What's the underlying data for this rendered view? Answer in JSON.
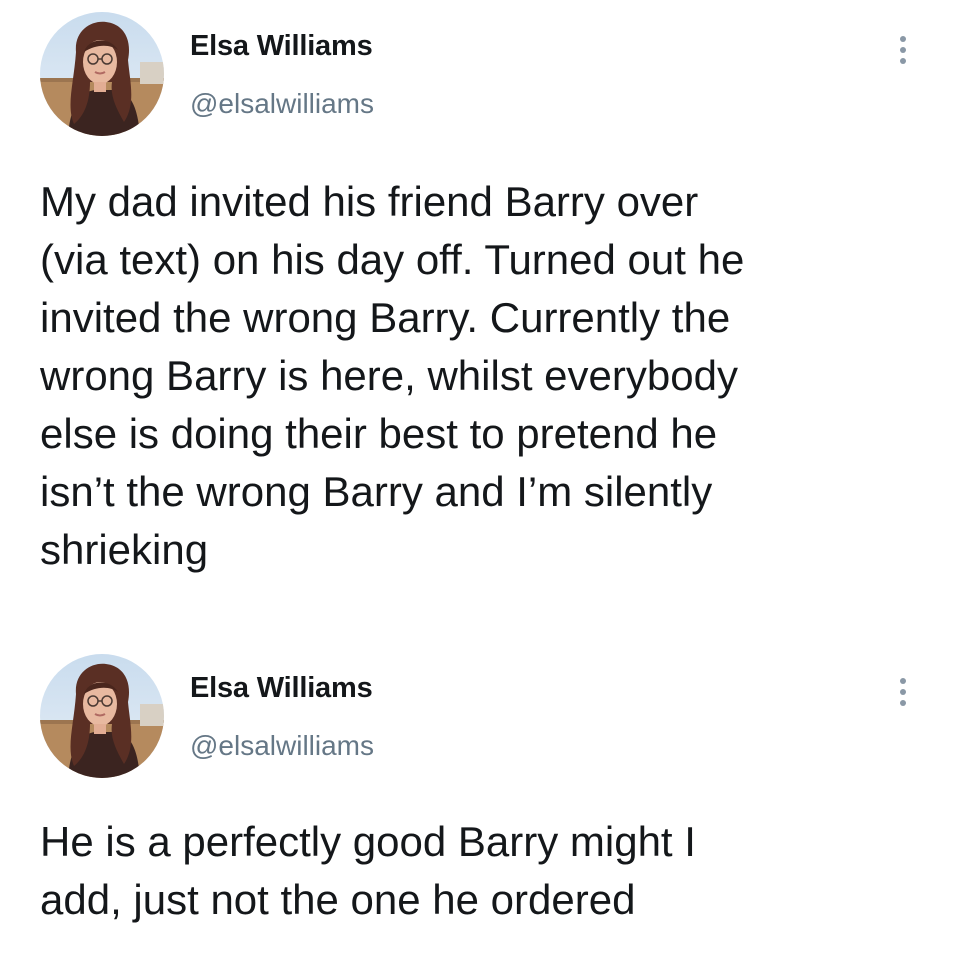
{
  "tweets": [
    {
      "author": {
        "display_name": "Elsa Williams",
        "handle": "@elsalwilliams",
        "avatar_icon": "profile-photo-avatar"
      },
      "menu_icon": "more-vertical-icon",
      "text": "My dad invited his friend Barry over\n(via text) on his day off. Turned out he\ninvited the wrong Barry. Currently the\nwrong Barry is here, whilst everybody\nelse is doing their best to pretend he\nisn’t the wrong Barry and I’m silently\nshrieking"
    },
    {
      "author": {
        "display_name": "Elsa Williams",
        "handle": "@elsalwilliams",
        "avatar_icon": "profile-photo-avatar"
      },
      "menu_icon": "more-vertical-icon",
      "text": "He is a perfectly good Barry might I\nadd, just not the one he ordered"
    }
  ],
  "colors": {
    "text_primary": "#14171a",
    "text_secondary": "#657786",
    "menu_dots": "#8a98a6",
    "background": "#ffffff"
  }
}
